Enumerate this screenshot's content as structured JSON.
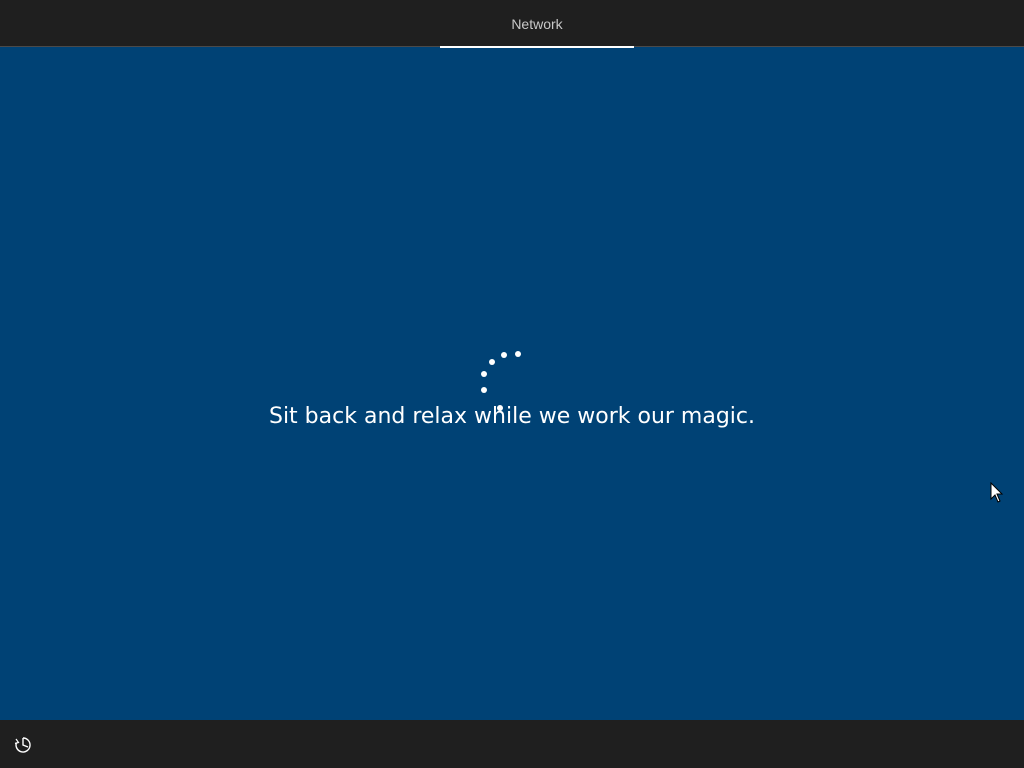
{
  "header": {
    "tabs": [
      {
        "label": "Network",
        "active": true
      }
    ]
  },
  "main": {
    "message": "Sit back and relax while we work our magic.",
    "spinner_icon": "loading-dots-icon"
  },
  "footer": {
    "ease_of_access_icon": "ease-of-access-icon"
  },
  "colors": {
    "background": "#004275",
    "bars": "#1f1f1f",
    "text": "#ffffff",
    "tab_text": "#c8c8c8"
  }
}
